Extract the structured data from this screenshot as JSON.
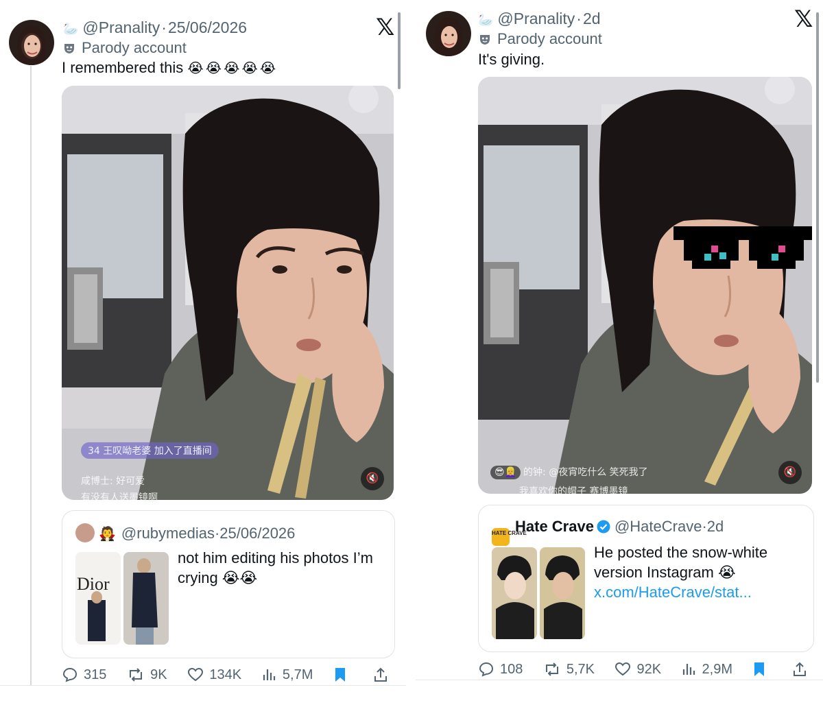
{
  "left_tweet": {
    "handle": "@Pranality",
    "timestamp": "25/06/2026",
    "account_label": "Parody account",
    "text": "I remembered this",
    "emojis": "😭😭😭😭😭",
    "media": {
      "overlay_join_badge": "34",
      "overlay_join": "王叹呦老婆 加入了直播间",
      "overlay_comment_1": "咸博士: 好可爱",
      "overlay_comment_2": "有没有人送墨镜啊"
    },
    "quote": {
      "handle": "@rubymedias",
      "timestamp": "25/06/2026",
      "text": "not him editing his photos I’m crying 😭😭",
      "thumb_caption": "Dior"
    },
    "stats": {
      "replies": "315",
      "reposts": "9K",
      "likes": "134K",
      "views": "5,7M"
    }
  },
  "right_tweet": {
    "handle": "@Pranality",
    "timestamp": "2d",
    "account_label": "Parody account",
    "text": "It's giving.",
    "media": {
      "overlay_comment_1": "的钟: @夜宵吃什么 笑死我了",
      "overlay_comment_2": "我喜欢你的帽子 赛博墨镜"
    },
    "quote": {
      "display_name": "Hate Crave",
      "handle": "@HateCrave",
      "timestamp": "2d",
      "text": "He posted the snow-white version Instagram 😭",
      "link": "x.com/HateCrave/stat...",
      "logo_text": "HATE CRAVE"
    },
    "stats": {
      "replies": "108",
      "reposts": "5,7K",
      "likes": "92K",
      "views": "2,9M"
    }
  },
  "separator": "·",
  "colors": {
    "link": "#1d9bf0",
    "muted": "#536471",
    "text": "#0f1419",
    "bookmark": "#1d9bf0"
  },
  "icons": [
    "swan-icon",
    "mask-icon",
    "x-logo-icon",
    "mute-icon",
    "verified-icon",
    "reply-icon",
    "repost-icon",
    "like-icon",
    "views-icon",
    "bookmark-icon",
    "share-icon"
  ]
}
